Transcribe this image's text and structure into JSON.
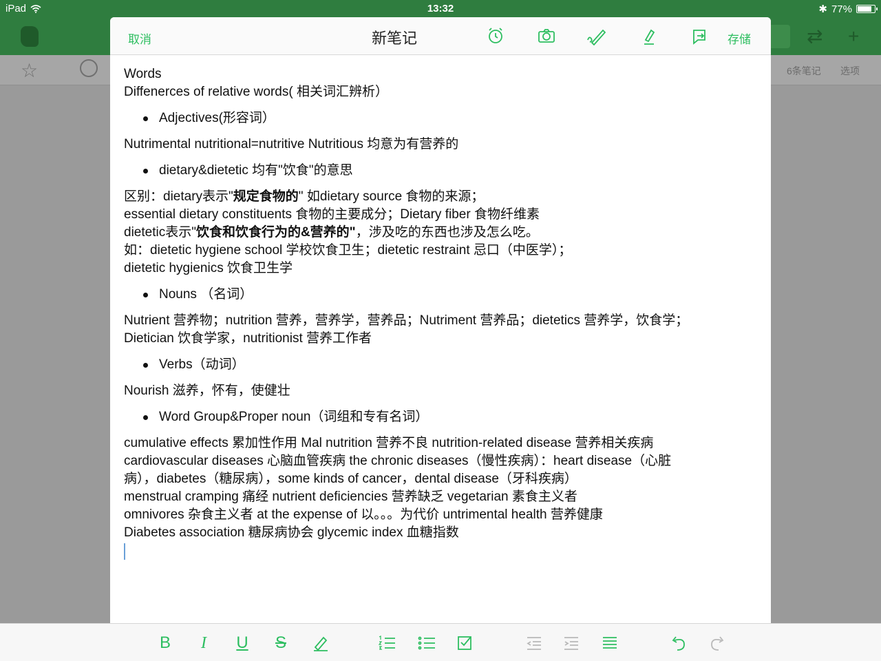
{
  "status": {
    "device": "iPad",
    "time": "13:32",
    "battery": "77%",
    "battery_level": 0.77
  },
  "background": {
    "note_count": "6条笔记",
    "options": "选项"
  },
  "editor": {
    "cancel": "取消",
    "title": "新笔记",
    "save": "存储",
    "toolbar_icons": [
      "alarm-icon",
      "camera-icon",
      "handwriting-icon",
      "pen-icon",
      "share-icon"
    ]
  },
  "note": {
    "l1": "Words",
    "l2": "Diffenerces of relative words( 相关词汇辨析）",
    "b1": "Adjectives(形容词）",
    "l3": "Nutrimental nutritional=nutritive Nutritious 均意为有营养的",
    "b2": "dietary&dietetic  均有\"饮食\"的意思",
    "l4a": "区别：dietary表示\"",
    "l4b": "规定食物的",
    "l4c": "\"        如dietary source 食物的来源；",
    "l5": "essential dietary constituents 食物的主要成分；Dietary fiber 食物纤维素",
    "l6a": "dietetic表示\"",
    "l6b": "饮食和饮食行为的&营养的\"",
    "l6c": "，涉及吃的东西也涉及怎么吃。",
    "l7": "如：dietetic hygiene school 学校饮食卫生；dietetic restraint 忌口（中医学）；",
    "l8": "dietetic hygienics 饮食卫生学",
    "b3": "Nouns （名词）",
    "l9": "Nutrient 营养物；nutrition 营养，营养学，营养品；Nutriment 营养品；dietetics 营养学，饮食学；",
    "l10": "Dietician 饮食学家，nutritionist 营养工作者",
    "b4": "Verbs（动词）",
    "l11": "Nourish 滋养，怀有，使健壮",
    "b5": "Word Group&Proper noun（词组和专有名词）",
    "l12": "cumulative effects 累加性作用      Mal nutrition 营养不良  nutrition-related disease  营养相关疾病",
    "l13": "cardiovascular diseases 心脑血管疾病    the chronic diseases（慢性疾病）：heart disease（心脏",
    "l14": "病），diabetes（糖尿病），some kinds of cancer，dental disease（牙科疾病）",
    "l15": "menstrual cramping 痛经     nutrient deficiencies 营养缺乏      vegetarian 素食主义者",
    "l16": "omnivores 杂食主义者     at the expense of 以。。。为代价 untrimental health 营养健康",
    "l17": "Diabetes association 糖尿病协会   glycemic index 血糖指数"
  },
  "format_toolbar": [
    "bold",
    "italic",
    "underline",
    "strikethrough",
    "highlight",
    "numbered-list",
    "bulleted-list",
    "checkbox",
    "outdent",
    "indent",
    "align",
    "undo",
    "redo"
  ]
}
